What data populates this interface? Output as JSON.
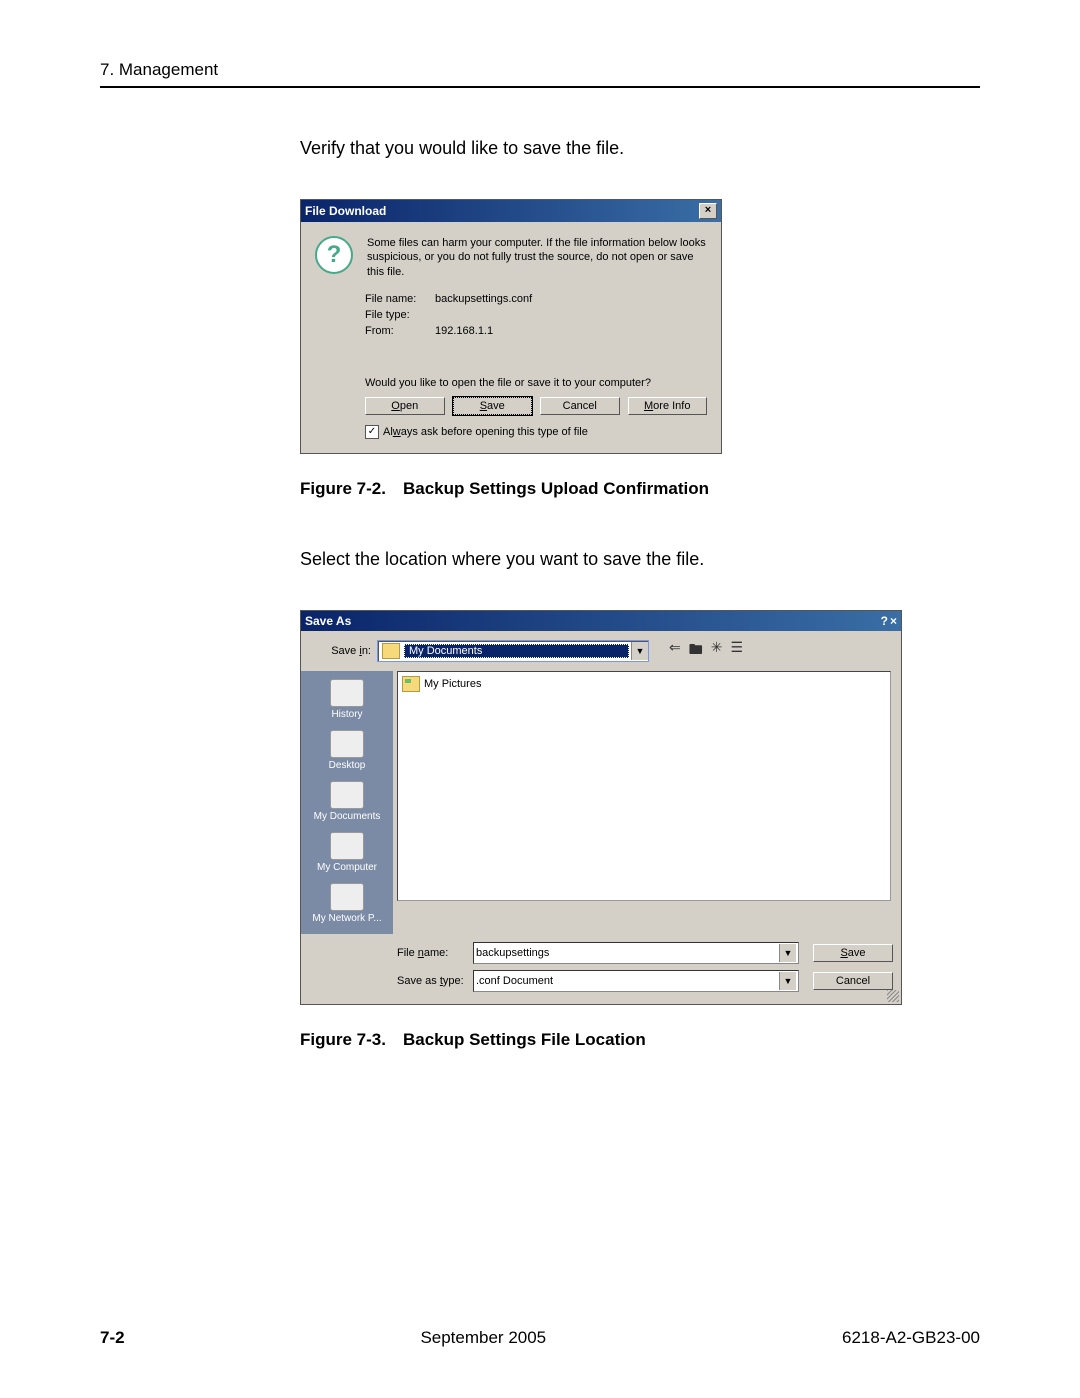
{
  "header": {
    "section": "7. Management"
  },
  "body": {
    "para1": "Verify that you would like to save the file.",
    "para2": "Select the location where you want to save the file."
  },
  "captions": {
    "fig72": "Figure 7-2. Backup Settings Upload Confirmation",
    "fig73": "Figure 7-3. Backup Settings File Location"
  },
  "dlg1": {
    "title": "File Download",
    "close": "×",
    "warning": "Some files can harm your computer. If the file information below looks suspicious, or you do not fully trust the source, do not open or save this file.",
    "labels": {
      "filename": "File name:",
      "filetype": "File type:",
      "from": "From:"
    },
    "values": {
      "filename": "backupsettings.conf",
      "filetype": "",
      "from": "192.168.1.1"
    },
    "prompt": "Would you like to open the file or save it to your computer?",
    "buttons": {
      "open": "Open",
      "save": "Save",
      "cancel": "Cancel",
      "more": "More Info"
    },
    "checkbox": "Always ask before opening this type of file"
  },
  "dlg2": {
    "title": "Save As",
    "help": "?",
    "close": "×",
    "savein_label": "Save in:",
    "savein_value": "My Documents",
    "nav": {
      "back": "⇐",
      "up": "🖿",
      "new": "✳",
      "views": "☰"
    },
    "places": [
      "History",
      "Desktop",
      "My Documents",
      "My Computer",
      "My Network P..."
    ],
    "listing": [
      "My Pictures"
    ],
    "labels": {
      "filename": "File name:",
      "saveas": "Save as type:"
    },
    "values": {
      "filename": "backupsettings",
      "saveas": ".conf Document"
    },
    "buttons": {
      "save": "Save",
      "cancel": "Cancel"
    }
  },
  "footer": {
    "page": "7-2",
    "date": "September 2005",
    "doc": "6218-A2-GB23-00"
  }
}
